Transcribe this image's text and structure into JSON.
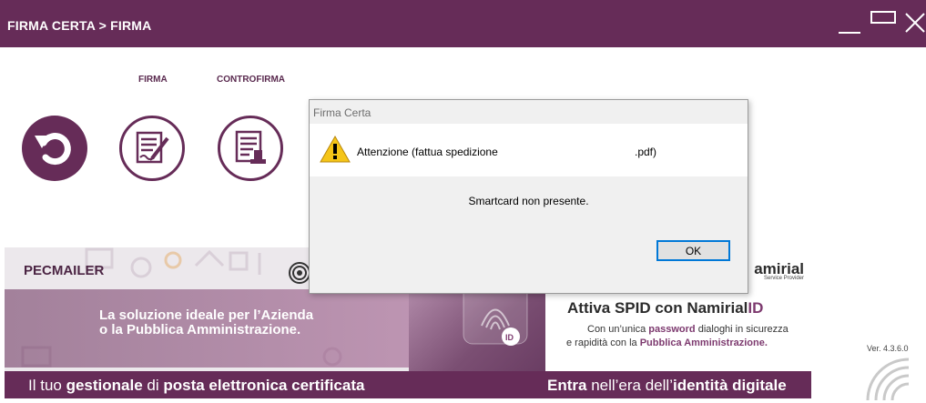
{
  "window": {
    "title": "FIRMA CERTA > FIRMA"
  },
  "toolbar": {
    "firma_label": "FIRMA",
    "controfirma_label": "CONTROFIRMA"
  },
  "icons": {
    "back": "refresh-icon",
    "sign": "sign-document-icon",
    "countersign": "countersign-document-icon",
    "warning": "warning-icon"
  },
  "banner": {
    "pecmailer": "PECMAILER",
    "tagline_1": "La soluzione ideale per l’Azienda",
    "tagline_2": "o la Pubblica Amministrazione.",
    "bottom_left_pre": "Il tuo ",
    "bottom_left_b1": "gestionale",
    "bottom_left_mid": " di ",
    "bottom_left_b2": "posta elettronica certificata",
    "bottom_right_b1": "Entra",
    "bottom_right_mid": " nell’era dell’",
    "bottom_right_b2": "identità digitale",
    "brand_right": "amirial",
    "brand_sub": "Service Provider",
    "spid_prefix": "Attiva SPID con ",
    "spid_brand": "Namirial",
    "spid_id": "ID",
    "desc_line1_pre": "Con un’unica ",
    "desc_line1_hl": "password",
    "desc_line1_post": " dialoghi in sicurezza",
    "desc_line2_pre": "e rapidità con la ",
    "desc_line2_hl": "Pubblica Amministrazione."
  },
  "version": "Ver. 4.3.6.0",
  "dialog": {
    "title": "Firma Certa",
    "message_part1": "Attenzione (fattua spedizione",
    "message_part2": ".pdf)",
    "message_detail": "Smartcard non presente.",
    "ok_label": "OK"
  },
  "colors": {
    "brand": "#662c58",
    "dialog_bg": "#f0f0f0",
    "button_focus": "#0078d7"
  }
}
